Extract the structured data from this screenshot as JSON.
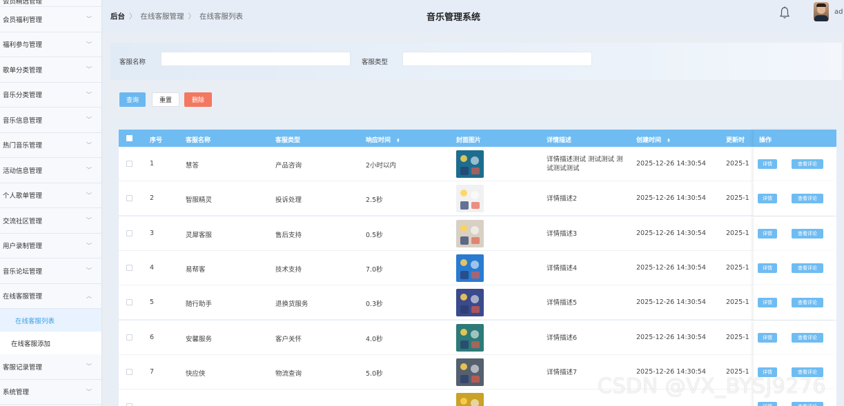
{
  "sidebar": {
    "items": [
      {
        "label": "会员精选管理",
        "chevron": "﹀"
      },
      {
        "label": "会员福利管理",
        "chevron": "﹀"
      },
      {
        "label": "福利参与管理",
        "chevron": "﹀"
      },
      {
        "label": "歌单分类管理",
        "chevron": "﹀"
      },
      {
        "label": "音乐分类管理",
        "chevron": "﹀"
      },
      {
        "label": "音乐信息管理",
        "chevron": "﹀"
      },
      {
        "label": "热门音乐管理",
        "chevron": "﹀"
      },
      {
        "label": "活动信息管理",
        "chevron": "﹀"
      },
      {
        "label": "个人歌单管理",
        "chevron": "﹀"
      },
      {
        "label": "交流社区管理",
        "chevron": "﹀"
      },
      {
        "label": "用户录制管理",
        "chevron": "﹀"
      },
      {
        "label": "音乐论坛管理",
        "chevron": "﹀"
      },
      {
        "label": "在线客服管理",
        "chevron": "︿"
      }
    ],
    "sub_items": [
      {
        "label": "在线客服列表",
        "active": true
      },
      {
        "label": "在线客服添加",
        "active": false
      }
    ],
    "bottom_items": [
      {
        "label": "客服记录管理",
        "chevron": "﹀"
      },
      {
        "label": "系统管理",
        "chevron": "﹀"
      }
    ]
  },
  "header": {
    "breadcrumb": [
      "后台",
      "在线客服管理",
      "在线客服列表"
    ],
    "breadcrumb_sep": "〉",
    "title": "音乐管理系统",
    "user": "ad"
  },
  "search": {
    "name_label": "客服名称",
    "name_value": "",
    "type_label": "客服类型",
    "type_value": ""
  },
  "actions": {
    "query": "查询",
    "reset": "重置",
    "delete": "删除"
  },
  "table": {
    "headers": {
      "index": "序号",
      "name": "客服名称",
      "type": "客服类型",
      "response": "响应时间",
      "cover": "封面图片",
      "desc": "详情描述",
      "created": "创建时间",
      "updated": "更新时",
      "ops": "操作"
    },
    "sort_icon": "⬍",
    "op_detail": "详情",
    "op_comment": "查看评论",
    "rows": [
      {
        "index": "1",
        "name": "慧答",
        "type": "产品咨询",
        "response": "2小时以内",
        "desc": "详情描述测试 测试测试 测试测试测试",
        "created": "2025-12-26 14:30:54",
        "updated": "2025-1"
      },
      {
        "index": "2",
        "name": "智服精灵",
        "type": "投诉处理",
        "response": "2.5秒",
        "desc": "详情描述2",
        "created": "2025-12-26 14:30:54",
        "updated": "2025-1"
      },
      {
        "index": "3",
        "name": "灵犀客服",
        "type": "售后支持",
        "response": "0.5秒",
        "desc": "详情描述3",
        "created": "2025-12-26 14:30:54",
        "updated": "2025-1"
      },
      {
        "index": "4",
        "name": "易帮客",
        "type": "技术支持",
        "response": "7.0秒",
        "desc": "详情描述4",
        "created": "2025-12-26 14:30:54",
        "updated": "2025-1"
      },
      {
        "index": "5",
        "name": "随行助手",
        "type": "退换货服务",
        "response": "0.3秒",
        "desc": "详情描述5",
        "created": "2025-12-26 14:30:54",
        "updated": "2025-1"
      },
      {
        "index": "6",
        "name": "安馨服务",
        "type": "客户关怀",
        "response": "4.0秒",
        "desc": "详情描述6",
        "created": "2025-12-26 14:30:54",
        "updated": "2025-1"
      },
      {
        "index": "7",
        "name": "快应侠",
        "type": "物流查询",
        "response": "5.0秒",
        "desc": "详情描述7",
        "created": "2025-12-26 14:30:54",
        "updated": "2025-1"
      }
    ],
    "thumb_colors": [
      "#1d6d8f",
      "#f1f1f1",
      "#d9d0c4",
      "#2a7bd0",
      "#3a4a8a",
      "#2d7a78",
      "#555f6e",
      "#c9a227"
    ]
  },
  "watermark": "CSDN @VX_BYSJ9276"
}
